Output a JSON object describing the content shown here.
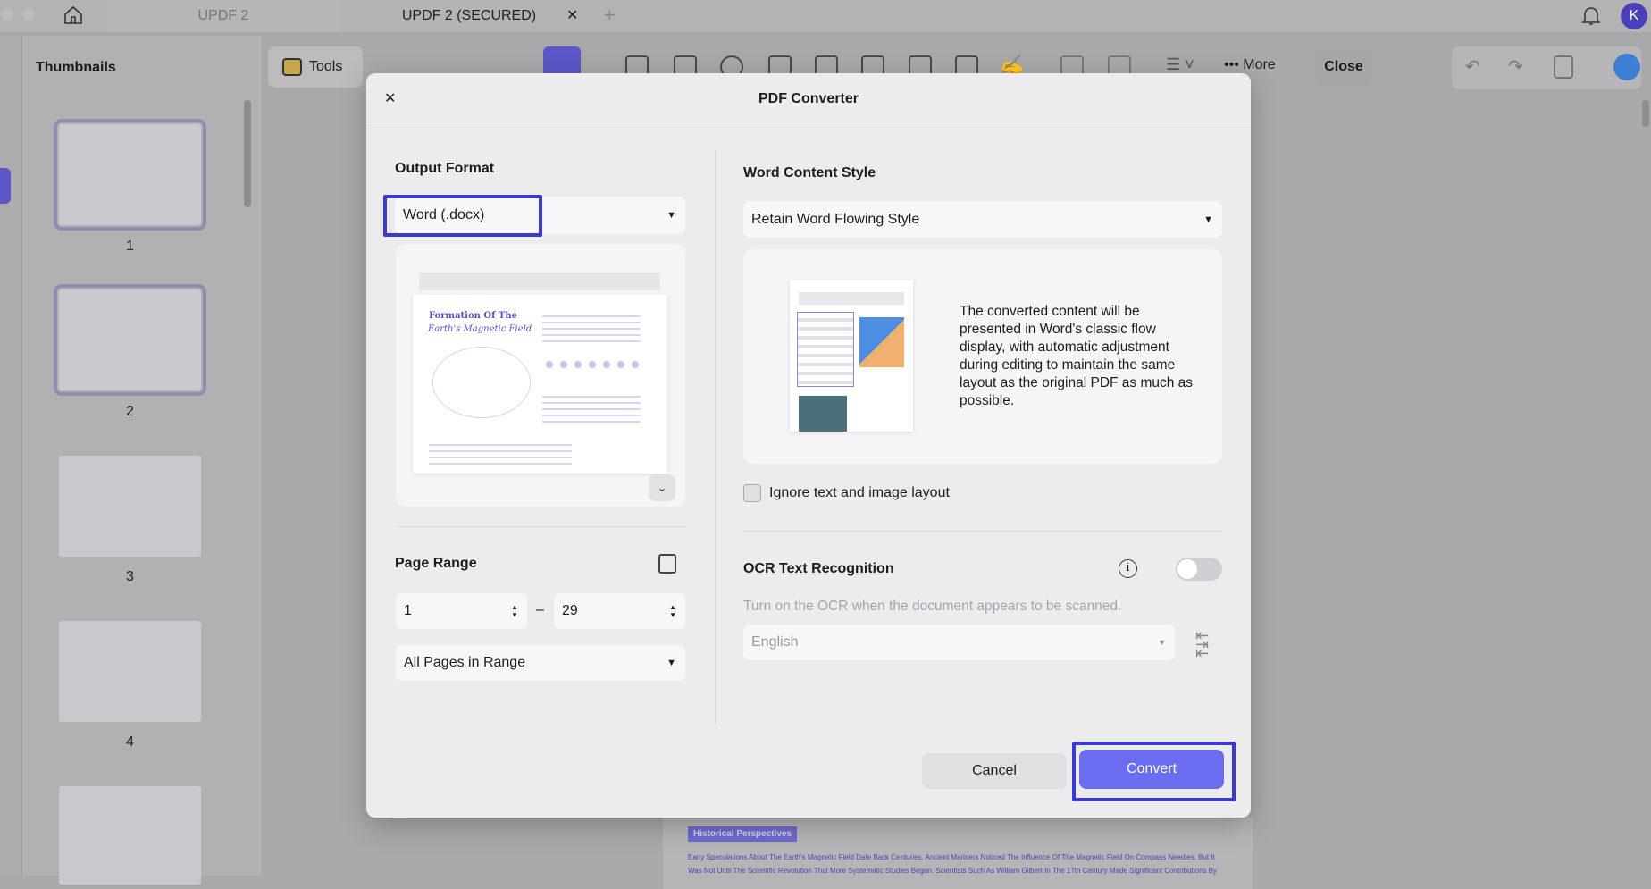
{
  "tabs": [
    {
      "label": "UPDF 2"
    },
    {
      "label": "UPDF 2 (SECURED)",
      "active": true
    }
  ],
  "user": {
    "avatar_initial": "K"
  },
  "sidebar": {
    "title": "Thumbnails",
    "pages": [
      "1",
      "2",
      "3",
      "4"
    ]
  },
  "toolbar": {
    "tools_label": "Tools",
    "more_label": "More",
    "close_label": "Close"
  },
  "document": {
    "section_label": "Historical Perspectives",
    "lines": [
      "Early Speculations About The Earth's Magnetic Field Date Back Centuries. Ancient Mariners Noticed The Influence Of The Magnetic Field On Compass Needles, But It",
      "Was Not Until The Scientific Revolution That More Systematic Studies Began. Scientists Such As William Gilbert In The 17th Century Made Significant Contributions By"
    ]
  },
  "dialog": {
    "title": "PDF Converter",
    "output_format": {
      "label": "Output Format",
      "value": "Word (.docx)",
      "preview_title_1": "Formation Of The",
      "preview_title_2": "Earth's Magnetic Field"
    },
    "page_range": {
      "label": "Page Range",
      "from": "1",
      "to": "29",
      "separator": "–",
      "subset": "All Pages in Range"
    },
    "word_style": {
      "label": "Word Content Style",
      "value": "Retain Word Flowing Style",
      "description": "The converted content will be presented in Word's classic flow display, with automatic adjustment during editing to maintain the same layout as the original PDF as much as possible."
    },
    "ignore_layout": {
      "label": "Ignore text and image layout",
      "checked": false
    },
    "ocr": {
      "label": "OCR Text Recognition",
      "enabled": false,
      "hint": "Turn on the OCR when the document appears to be scanned.",
      "language": "English"
    },
    "cancel_label": "Cancel",
    "convert_label": "Convert",
    "accent": "#6c6cf0"
  }
}
